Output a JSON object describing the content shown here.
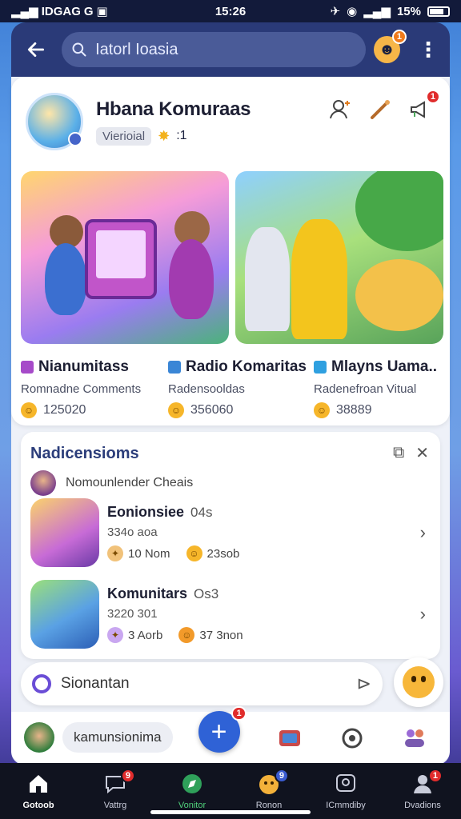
{
  "status_bar": {
    "left": "IDGAG",
    "time": "15:26",
    "battery": "15%"
  },
  "appbar": {
    "search_value": "Iatorl Ioasia",
    "avatar_badge": "1"
  },
  "community": {
    "title": "Hbana Komuraas",
    "chip": "Vierioial",
    "sparkle": ":1",
    "badge": "1"
  },
  "tiles": [
    {
      "name": "Nianumitass",
      "desc": "Romnadne Comments",
      "count": "125020",
      "color": "#a64ac9"
    },
    {
      "name": "Radio Komaritas",
      "desc": "Radensooldas",
      "count": "356060",
      "color": "#3a86d6"
    },
    {
      "name": "Mlayns Uama..",
      "desc": "Radenefroan Vitual",
      "count": "38889",
      "color": "#2fa0e0"
    }
  ],
  "notifications": {
    "title": "Nadicensioms",
    "sender": "Nomounlender  Cheais",
    "items": [
      {
        "title": "Eonionsiee",
        "time": "04s",
        "sub": "334o aoa",
        "stat1": "10 Nom",
        "stat2": "23sob"
      },
      {
        "title": "Komunitars",
        "time": "Os3",
        "sub": "3220 301",
        "stat1": "3 Aorb",
        "stat2": "37 3non"
      }
    ]
  },
  "composer": {
    "value": "Sionantan"
  },
  "actionbar": {
    "pill": "kamunsionima",
    "plus_badge": "1"
  },
  "bottom_nav": [
    {
      "label": "Gotoob",
      "icon": "home-icon",
      "active": true,
      "badge": ""
    },
    {
      "label": "Vattrg",
      "icon": "chat-icon",
      "active": false,
      "badge": "9"
    },
    {
      "label": "Vonitor",
      "icon": "compass-icon",
      "active": false,
      "badge": ""
    },
    {
      "label": "Ronon",
      "icon": "mascot-icon",
      "active": false,
      "badge": "9"
    },
    {
      "label": "ICmmdiby",
      "icon": "community-icon",
      "active": false,
      "badge": ""
    },
    {
      "label": "Dvadions",
      "icon": "profile-icon",
      "active": false,
      "badge": "1"
    }
  ],
  "colors": {
    "accent": "#2f62d6",
    "header": "#2a3a78",
    "badge": "#e02c2c",
    "title_blue": "#2b3d7a"
  }
}
